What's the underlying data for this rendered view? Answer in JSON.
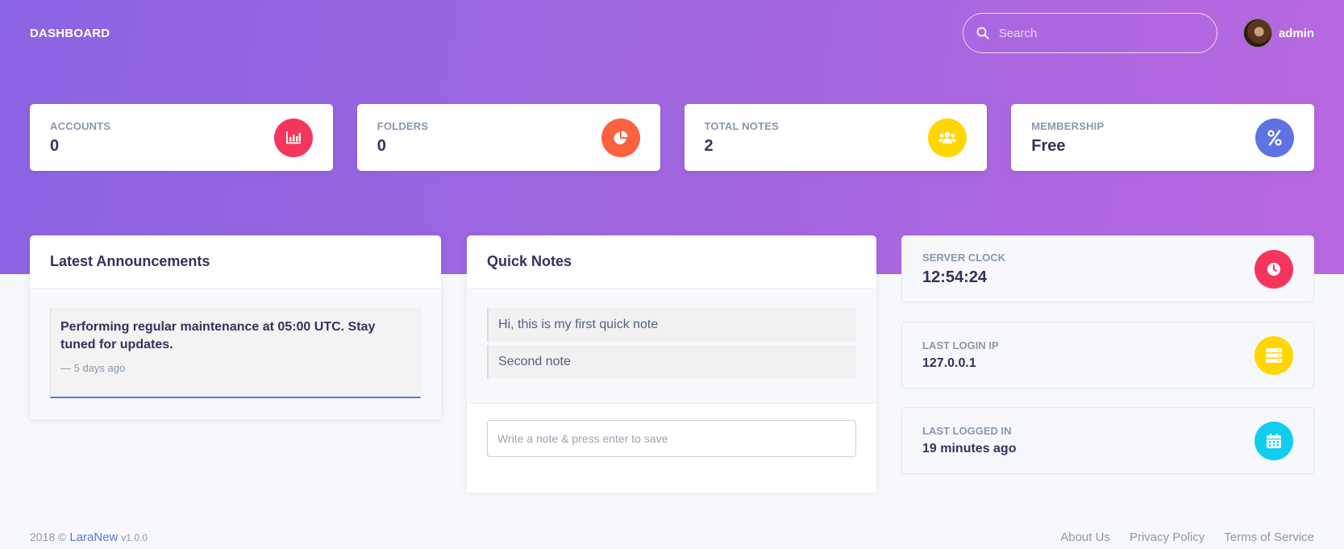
{
  "header": {
    "brand": "DASHBOARD",
    "search_placeholder": "Search",
    "user_name": "admin"
  },
  "stats": [
    {
      "label": "ACCOUNTS",
      "value": "0",
      "icon": "bar-chart-icon",
      "color": "#f5365c"
    },
    {
      "label": "FOLDERS",
      "value": "0",
      "icon": "pie-chart-icon",
      "color": "#fb6340"
    },
    {
      "label": "TOTAL NOTES",
      "value": "2",
      "icon": "users-icon",
      "color": "#ffd600"
    },
    {
      "label": "MEMBERSHIP",
      "value": "Free",
      "icon": "percent-icon",
      "color": "#5e72e4"
    }
  ],
  "announcements": {
    "title": "Latest Announcements",
    "items": [
      {
        "text": "Performing regular maintenance at 05:00 UTC. Stay tuned for updates.",
        "meta": "— 5 days ago"
      }
    ]
  },
  "quick_notes": {
    "title": "Quick Notes",
    "items": [
      "Hi, this is my first quick note",
      "Second note"
    ],
    "input_placeholder": "Write a note & press enter to save"
  },
  "side_cards": [
    {
      "label": "SERVER CLOCK",
      "value": "12:54:24",
      "icon": "clock-icon",
      "color": "#f5365c"
    },
    {
      "label": "LAST LOGIN IP",
      "value": "127.0.0.1",
      "icon": "server-icon",
      "color": "#ffd600"
    },
    {
      "label": "LAST LOGGED IN",
      "value": "19 minutes ago",
      "icon": "calendar-icon",
      "color": "#11cdef"
    }
  ],
  "footer": {
    "copyright": "2018 ©",
    "brand": "LaraNew",
    "version": "v1.0.0",
    "links": [
      "About Us",
      "Privacy Policy",
      "Terms of Service"
    ]
  }
}
